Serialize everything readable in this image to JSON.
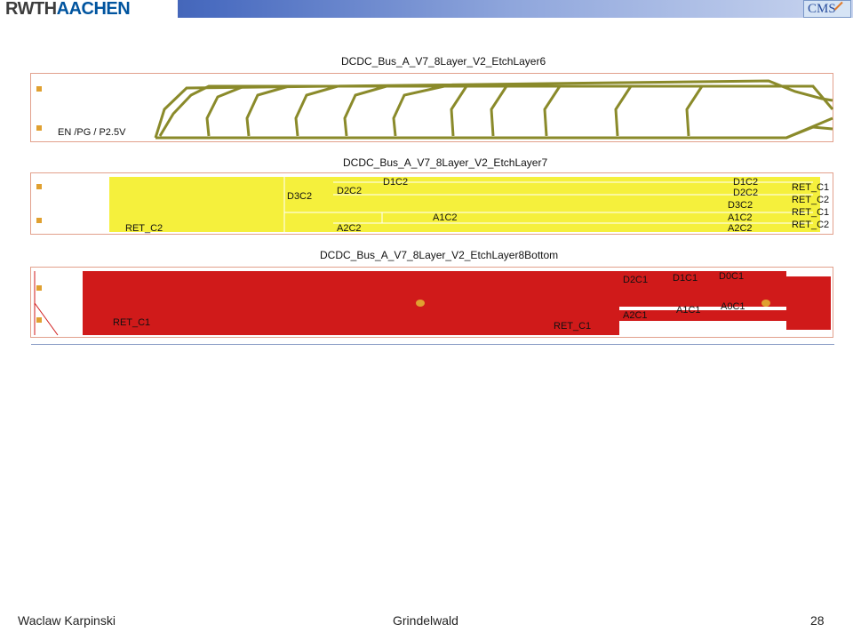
{
  "header": {
    "logo_text_a": "RWTH",
    "logo_text_b": "AACHEN",
    "experiment_badge": "CMS",
    "accent_color": "#2a4b9a"
  },
  "boards": [
    {
      "title": "DCDC_Bus_A_V7_8Layer_V2_EtchLayer6",
      "fill_color": "#8a8a2a",
      "labels": [
        "EN /PG / P2.5V"
      ]
    },
    {
      "title": "DCDC_Bus_A_V7_8Layer_V2_EtchLayer7",
      "fill_color": "#f5f03c",
      "labels": [
        "D3C2",
        "D2C2",
        "D1C2",
        "A1C2",
        "A2C2",
        "RET_C2",
        "D1C2",
        "D2C2",
        "D3C2",
        "A1C2",
        "A2C2",
        "RET_C1",
        "RET_C2",
        "RET_C1",
        "RET_C2"
      ]
    },
    {
      "title": "DCDC_Bus_A_V7_8Layer_V2_EtchLayer8Bottom",
      "fill_color": "#d01a1a",
      "labels": [
        "RET_C1",
        "RET_C1",
        "D2C1",
        "D1C1",
        "D0C1",
        "A2C1",
        "A1C1",
        "A0C1"
      ]
    }
  ],
  "footer": {
    "author": "Waclaw Karpinski",
    "location": "Grindelwald",
    "page_number": "28"
  }
}
